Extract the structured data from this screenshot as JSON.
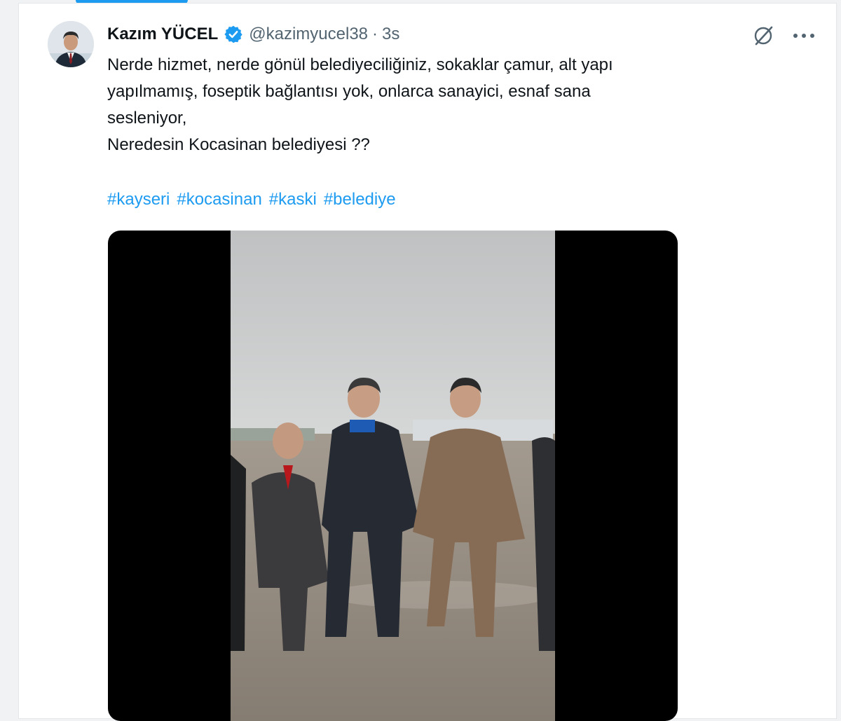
{
  "tweet": {
    "author_name": "Kazım YÜCEL",
    "handle": "@kazimyucel38",
    "separator": "·",
    "time": "3s",
    "text_lines": [
      "Nerde hizmet, nerde gönül belediyeciliğiniz, sokaklar çamur, alt yapı",
      "yapılmamış, foseptik bağlantısı yok, onlarca sanayici, esnaf sana",
      "sesleniyor,",
      "Neredesin Kocasinan belediyesi ??"
    ],
    "hashtags": [
      "#kayseri",
      "#kocasinan",
      "#kaski",
      "#belediye"
    ]
  },
  "icons": {
    "verified": "verified-badge-icon",
    "grok": "grok-icon",
    "more": "more-icon"
  },
  "colors": {
    "accent": "#1d9bf0",
    "text": "#0f1419",
    "secondary": "#536471",
    "video_background": "#000000"
  }
}
